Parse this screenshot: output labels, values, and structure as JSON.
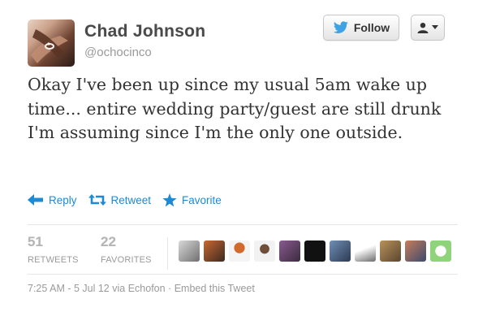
{
  "user": {
    "name": "Chad Johnson",
    "handle": "@ochocinco"
  },
  "buttons": {
    "follow_label": "Follow"
  },
  "tweet": {
    "text": "Okay I've been up since my usual 5am wake up time... entire wedding party/guest are still drunk I'm assuming since I'm the only one outside."
  },
  "actions": {
    "reply": "Reply",
    "retweet": "Retweet",
    "favorite": "Favorite"
  },
  "stats": {
    "retweets_count": "51",
    "retweets_label": "RETWEETS",
    "favorites_count": "22",
    "favorites_label": "FAVORITES"
  },
  "meta": {
    "timestamp": "7:25 AM - 5 Jul 12",
    "via_prefix": " via ",
    "client": "Echofon",
    "separator": " · ",
    "embed": "Embed this Tweet"
  },
  "colors": {
    "link": "#1d8ad6",
    "text": "#333333",
    "muted": "#9a9a9a"
  },
  "icons": {
    "follow": "twitter-bird-icon",
    "user_menu": "user-icon",
    "reply": "reply-arrow-icon",
    "retweet": "retweet-icon",
    "favorite": "star-icon"
  }
}
